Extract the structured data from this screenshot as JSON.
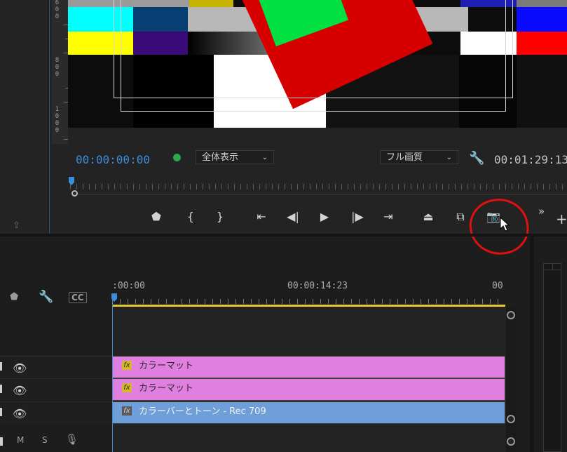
{
  "left_panel": {
    "icon": "export-frame-icon"
  },
  "ruler_labels": [
    "6",
    "0",
    "0",
    "8",
    "0",
    "0",
    "1",
    "0",
    "0",
    "0"
  ],
  "monitor": {
    "timecode_current": "00:00:00:00",
    "timecode_duration": "00:01:29:13",
    "zoom_select": "全体表示",
    "quality_select": "フル画質"
  },
  "transport": {
    "buttons": [
      "add-marker",
      "mark-in",
      "mark-out",
      "go-to-in",
      "step-back",
      "play",
      "step-forward",
      "go-to-out",
      "lift",
      "extract",
      "export-frame"
    ]
  },
  "timeline": {
    "ruler_labels": [
      ":00:00",
      "00:00:14:23",
      "00"
    ],
    "clips": [
      {
        "name": "カラーマット",
        "fx": "fx"
      },
      {
        "name": "カラーマット",
        "fx": "fx"
      },
      {
        "name": "カラーバーとトーン - Rec 709",
        "fx": "fx"
      }
    ],
    "audio_labels": {
      "mute": "M",
      "solo": "S"
    },
    "header_tools": {
      "cc": "CC"
    }
  },
  "colors": {
    "accent_blue": "#3b8ddb",
    "annotation_red": "#e01010",
    "clip_pink": "#e07fdf",
    "clip_blue": "#6f9fd8",
    "timeline_yellow": "#e6c92b"
  }
}
